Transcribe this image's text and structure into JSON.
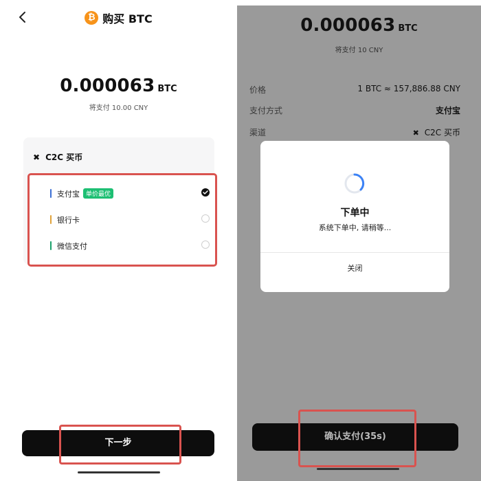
{
  "left": {
    "header": {
      "coin_symbol": "₿",
      "title": "购买 BTC"
    },
    "amount": {
      "value": "0.000063",
      "unit": "BTC",
      "pay_note": "将支付 10.00 CNY"
    },
    "channel_card": {
      "title": "C2C 买币",
      "options": [
        {
          "label": "支付宝",
          "tag": "单价最优",
          "selected": true,
          "color": "#3b6fd4"
        },
        {
          "label": "银行卡",
          "tag": "",
          "selected": false,
          "color": "#e0a23a"
        },
        {
          "label": "微信支付",
          "tag": "",
          "selected": false,
          "color": "#1aa06a"
        }
      ]
    },
    "next_button_label": "下一步"
  },
  "right": {
    "amount": {
      "value": "0.000063",
      "unit": "BTC",
      "pay_note": "将支付 10 CNY"
    },
    "info": {
      "price_label": "价格",
      "price_value": "1 BTC ≈ 157,886.88 CNY",
      "method_label": "支付方式",
      "method_value": "支付宝",
      "channel_label": "渠道",
      "channel_value": "C2C 买币"
    },
    "dialog": {
      "title": "下单中",
      "message": "系统下单中, 请稍等...",
      "close_label": "关闭"
    },
    "confirm_button_label": "确认支付(35s)"
  },
  "colors": {
    "highlight": "#d9534f",
    "bitcoin_orange": "#f7931a",
    "tag_green": "#1dbf73",
    "spinner_blue": "#3b82f6",
    "overlay_gray": "#9a9a9a"
  }
}
